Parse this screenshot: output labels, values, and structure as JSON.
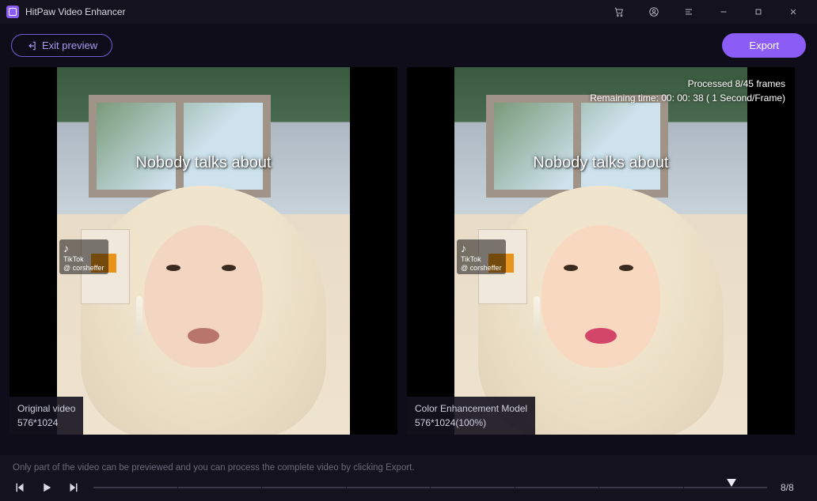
{
  "app_title": "HitPaw Video Enhancer",
  "top": {
    "exit_label": "Exit preview",
    "export_label": "Export"
  },
  "panels": {
    "left": {
      "label_line1": "Original video",
      "label_line2": "576*1024",
      "caption": "Nobody talks about",
      "watermark_brand": "TikTok",
      "watermark_user": "@ corsheffer"
    },
    "right": {
      "label_line1": "Color Enhancement Model",
      "label_line2": "576*1024(100%)",
      "caption": "Nobody talks about",
      "watermark_brand": "TikTok",
      "watermark_user": "@ corsheffer",
      "status_line1": "Processed 8/45 frames",
      "status_line2": "Remaining time: 00: 00: 38 ( 1 Second/Frame)"
    }
  },
  "footer": {
    "hint": "Only part of the video can be previewed and you can process the complete video by clicking Export.",
    "frame_counter": "8/8"
  },
  "colors": {
    "accent": "#8b5cf6",
    "accent_border": "#6d5dd3"
  }
}
